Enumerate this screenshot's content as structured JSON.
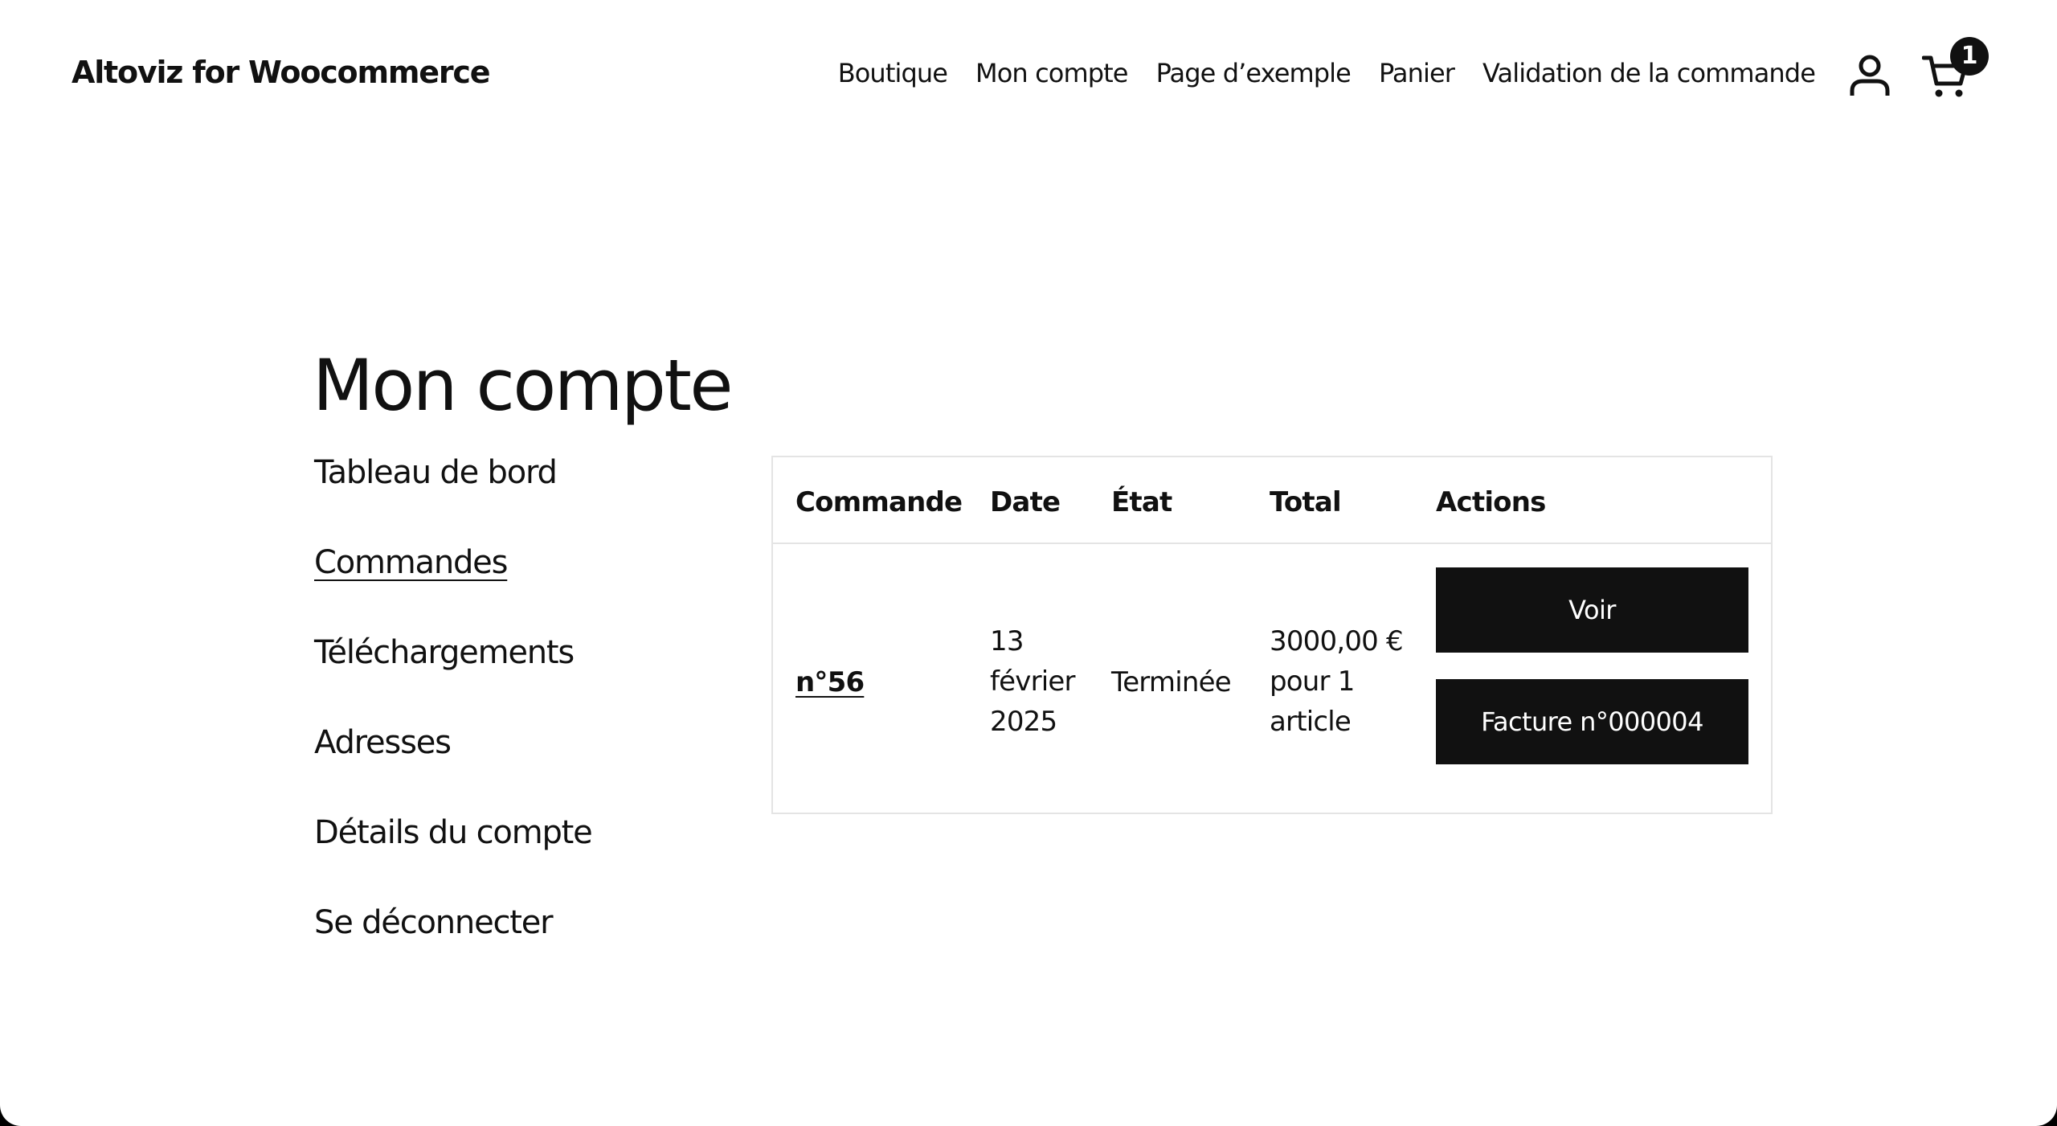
{
  "header": {
    "site_title": "Altoviz for Woocommerce",
    "nav": [
      {
        "label": "Boutique"
      },
      {
        "label": "Mon compte"
      },
      {
        "label": "Page d’exemple"
      },
      {
        "label": "Panier"
      },
      {
        "label": "Validation de la commande"
      }
    ],
    "account_icon": "user-icon",
    "cart_icon": "cart-icon",
    "cart_count": "1"
  },
  "page": {
    "title": "Mon compte"
  },
  "account_nav": [
    {
      "label": "Tableau de bord",
      "active": false
    },
    {
      "label": "Commandes",
      "active": true
    },
    {
      "label": "Téléchargements",
      "active": false
    },
    {
      "label": "Adresses",
      "active": false
    },
    {
      "label": "Détails du compte",
      "active": false
    },
    {
      "label": "Se déconnecter",
      "active": false
    }
  ],
  "orders": {
    "columns": [
      "Commande",
      "Date",
      "État",
      "Total",
      "Actions"
    ],
    "rows": [
      {
        "order": "n°56",
        "date_lines": [
          "13",
          "février",
          "2025"
        ],
        "status": "Terminée",
        "total_lines": [
          "3000,00 €",
          "pour 1",
          "article"
        ],
        "actions": [
          "Voir",
          "Facture n°000004"
        ]
      }
    ]
  },
  "colors": {
    "text": "#111111",
    "button_bg": "#111111",
    "button_text": "#ffffff",
    "border": "#e4e4e4",
    "background": "#ffffff"
  }
}
